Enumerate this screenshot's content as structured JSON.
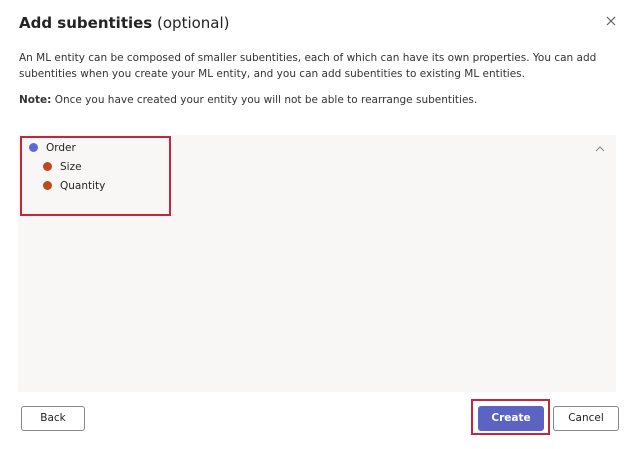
{
  "dialog": {
    "title": "Add subentities",
    "title_suffix": "(optional)",
    "description": "An ML entity can be composed of smaller subentities, each of which can have its own properties. You can add subentities when you create your ML entity, and you can add subentities to existing ML entities.",
    "note_label": "Note:",
    "note_text": "Once you have created your entity you will not be able to rearrange subentities."
  },
  "tree": {
    "root": {
      "label": "Order",
      "color": "#5b6ad7"
    },
    "children": [
      {
        "label": "Size",
        "color": "#c0481b"
      },
      {
        "label": "Quantity",
        "color": "#c0481b"
      }
    ]
  },
  "footer": {
    "back_label": "Back",
    "create_label": "Create",
    "cancel_label": "Cancel"
  },
  "colors": {
    "primary": "#5b63c3",
    "highlight": "#c4263c",
    "panel_bg": "#f8f7f5"
  },
  "icons": [
    "close-icon",
    "chevron-up-icon"
  ]
}
